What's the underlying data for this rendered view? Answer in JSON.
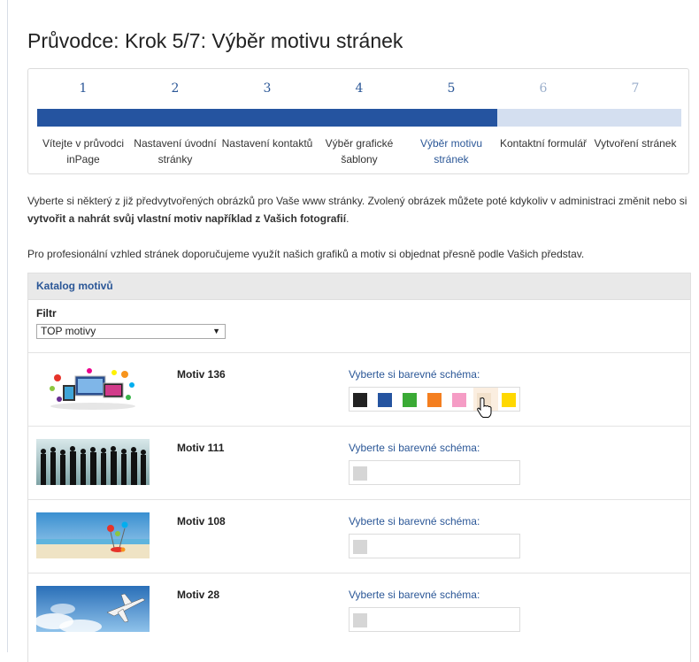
{
  "page": {
    "title": "Průvodce: Krok 5/7: Výběr motivu stránek"
  },
  "wizard": {
    "steps": [
      {
        "num": "1",
        "label": "Vítejte v průvodci inPage"
      },
      {
        "num": "2",
        "label": "Nastavení úvodní stránky"
      },
      {
        "num": "3",
        "label": "Nastavení kontaktů"
      },
      {
        "num": "4",
        "label": "Výběr grafické šablony"
      },
      {
        "num": "5",
        "label": "Výběr motivu stránek"
      },
      {
        "num": "6",
        "label": "Kontaktní formulář"
      },
      {
        "num": "7",
        "label": "Vytvoření stránek"
      }
    ],
    "current_step": 5,
    "total_steps": 7,
    "colors": {
      "done": "#2554a0",
      "todo": "#d4dff0"
    }
  },
  "intro": {
    "p1_text": "Vyberte si některý z již předvytvořených obrázků pro Vaše www stránky. Zvolený obrázek můžete poté kdykoliv v administraci změnit nebo si ",
    "p1_bold": "vytvořit a nahrát svůj vlastní motiv například z Vašich fotografií",
    "p1_end": ".",
    "p2": "Pro profesionální vzhled stránek doporučujeme využít našich grafiků a motiv si objednat přesně podle Vašich představ."
  },
  "catalog": {
    "header": "Katalog motivů",
    "filter_label": "Filtr",
    "filter_selected": "TOP motivy",
    "schema_label": "Vyberte si barevné schéma:",
    "motifs": [
      {
        "name": "Motiv 136",
        "image": "devices-illustration",
        "swatches": [
          "#222222",
          "#2554a0",
          "#3aaa35",
          "#f47f20",
          "#f59cc5",
          "#f2e1cc",
          "#ffd800"
        ],
        "selected_swatch": 5
      },
      {
        "name": "Motiv 111",
        "image": "silhouettes-photo",
        "swatches": []
      },
      {
        "name": "Motiv 108",
        "image": "beach-photo",
        "swatches": []
      },
      {
        "name": "Motiv 28",
        "image": "airplane-photo",
        "swatches": []
      }
    ]
  }
}
